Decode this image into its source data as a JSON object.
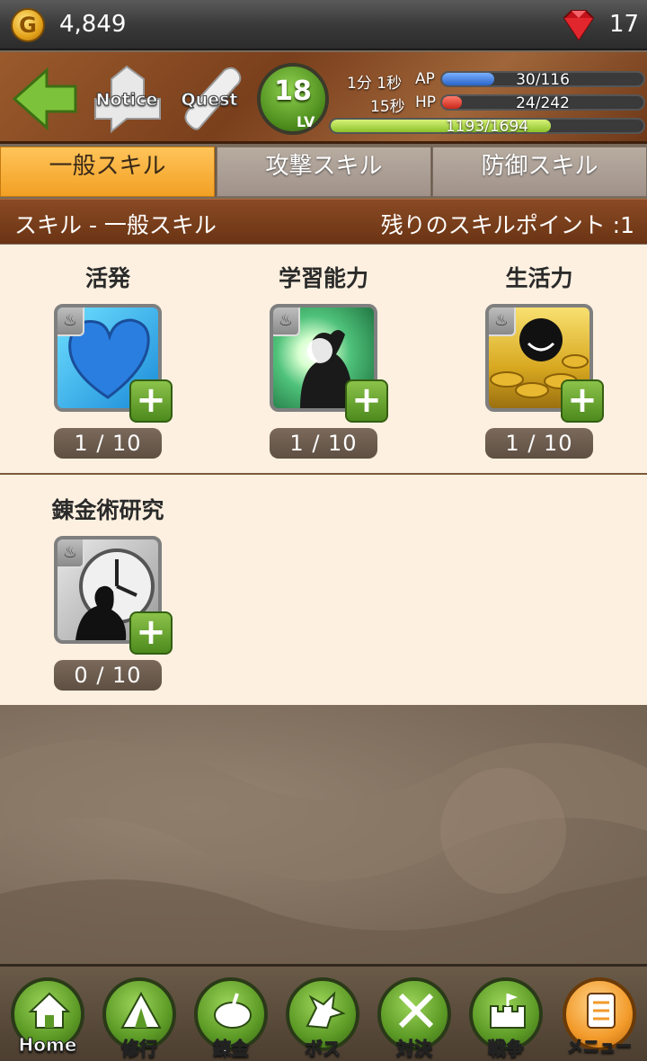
{
  "currency": {
    "gold": "4,849",
    "coin_symbol": "G",
    "gems": "17"
  },
  "header": {
    "notice_label": "Notice",
    "quest_label": "Quest",
    "level": "18",
    "level_label": "LV",
    "ap_timer": "1分 1秒",
    "ap_label": "AP",
    "ap_value": "30/116",
    "ap_fraction": 0.26,
    "hp_timer": "15秒",
    "hp_label": "HP",
    "hp_value": "24/242",
    "hp_fraction": 0.1,
    "exp_value": "1193/1694",
    "exp_fraction": 0.704
  },
  "tabs": [
    {
      "label": "一般スキル",
      "active": true
    },
    {
      "label": "攻撃スキル",
      "active": false
    },
    {
      "label": "防御スキル",
      "active": false
    }
  ],
  "section": {
    "title": "スキル - 一般スキル",
    "points": "残りのスキルポイント :1"
  },
  "skills": [
    {
      "name": "活発",
      "level": "1 / 10",
      "icon": "blue-heart-icon"
    },
    {
      "name": "学習能力",
      "level": "1 / 10",
      "icon": "glowing-mind-icon"
    },
    {
      "name": "生活力",
      "level": "1 / 10",
      "icon": "gold-coins-icon"
    },
    {
      "name": "錬金術研究",
      "level": "0 / 10",
      "icon": "clock-research-icon"
    }
  ],
  "nav": [
    {
      "label": "Home",
      "icon": "home-icon"
    },
    {
      "label": "修行",
      "icon": "tent-icon"
    },
    {
      "label": "錬金",
      "icon": "cauldron-icon"
    },
    {
      "label": "ボス",
      "icon": "dragon-icon"
    },
    {
      "label": "対決",
      "icon": "crossed-swords-icon"
    },
    {
      "label": "戦争",
      "icon": "castle-icon"
    },
    {
      "label": "メニュー",
      "icon": "menu-list-icon"
    }
  ],
  "colors": {
    "accent_tab": "#f2a024",
    "section_bar": "#7a3f1c",
    "plus_button": "#6aa832",
    "ap_bar": "#3a7bd8",
    "hp_bar": "#d83a2a",
    "exp_bar": "#a8d83a"
  }
}
